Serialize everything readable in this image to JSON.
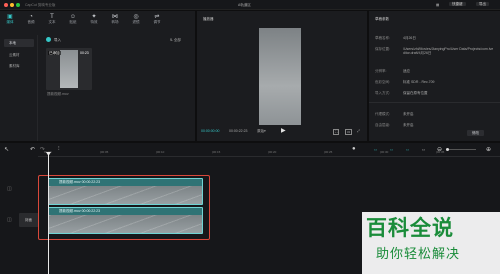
{
  "window": {
    "title": "A轨道区",
    "app_name": "CapCut 剪映专业版"
  },
  "titlebar": {
    "shortcut_label": "快捷键",
    "export_label": "导出"
  },
  "media_tabs": [
    {
      "label": "媒体",
      "icon": "media-icon"
    },
    {
      "label": "音频",
      "icon": "audio-icon"
    },
    {
      "label": "文本",
      "icon": "text-icon"
    },
    {
      "label": "贴纸",
      "icon": "sticker-icon"
    },
    {
      "label": "特效",
      "icon": "effects-icon"
    },
    {
      "label": "转场",
      "icon": "transition-icon"
    },
    {
      "label": "滤镜",
      "icon": "filter-icon"
    },
    {
      "label": "调节",
      "icon": "adjust-icon"
    }
  ],
  "sidebar": {
    "items": [
      {
        "label": "本地"
      },
      {
        "label": "云素材"
      },
      {
        "label": "素材库"
      }
    ]
  },
  "media_toolbar": {
    "import_label": "导入",
    "view_label": "全部"
  },
  "media_clip": {
    "badge": "已添加",
    "duration": "00:23",
    "filename": "提款视频.mov"
  },
  "player": {
    "title": "播放器",
    "current_time": "00:00:00:00",
    "total_time": "00:00:22:23",
    "ratio_label": "原始"
  },
  "draft": {
    "title": "草稿参数",
    "rows": [
      {
        "label": "草稿名称:",
        "value": "4月26日"
      },
      {
        "label": "保存位置:",
        "value": "/Users/zhi/Movies/JianyingPro/User Data/Projects/com.lveditor.draft/4月26日"
      },
      {
        "label": "分辨率:",
        "value": "适应"
      },
      {
        "label": "色彩空间:",
        "value": "标准 SDR - Rec.709"
      },
      {
        "label": "导入方式:",
        "value": "保留在原有位置"
      },
      {
        "label": "代理模式:",
        "value": "未开启"
      },
      {
        "label": "自由层级:",
        "value": "未开启"
      }
    ],
    "modify_label": "修改"
  },
  "timeline": {
    "ruler": [
      "00:00",
      "|00:05",
      "|00:10",
      "|00:15",
      "|00:20",
      "|00:25",
      "|00:30",
      "|00:35"
    ],
    "tracks": [
      {
        "name": "提款视频.mov",
        "time": "00:00:22:23"
      },
      {
        "name": "提款视频.mov",
        "time": "00:00:22:23"
      }
    ],
    "cover_label": "封面"
  },
  "watermark": {
    "line1": "百科全说",
    "line2": "助你轻松解决"
  },
  "colors": {
    "accent": "#35c7c7",
    "selection": "#d9483b",
    "track": "#3a8a8d"
  }
}
